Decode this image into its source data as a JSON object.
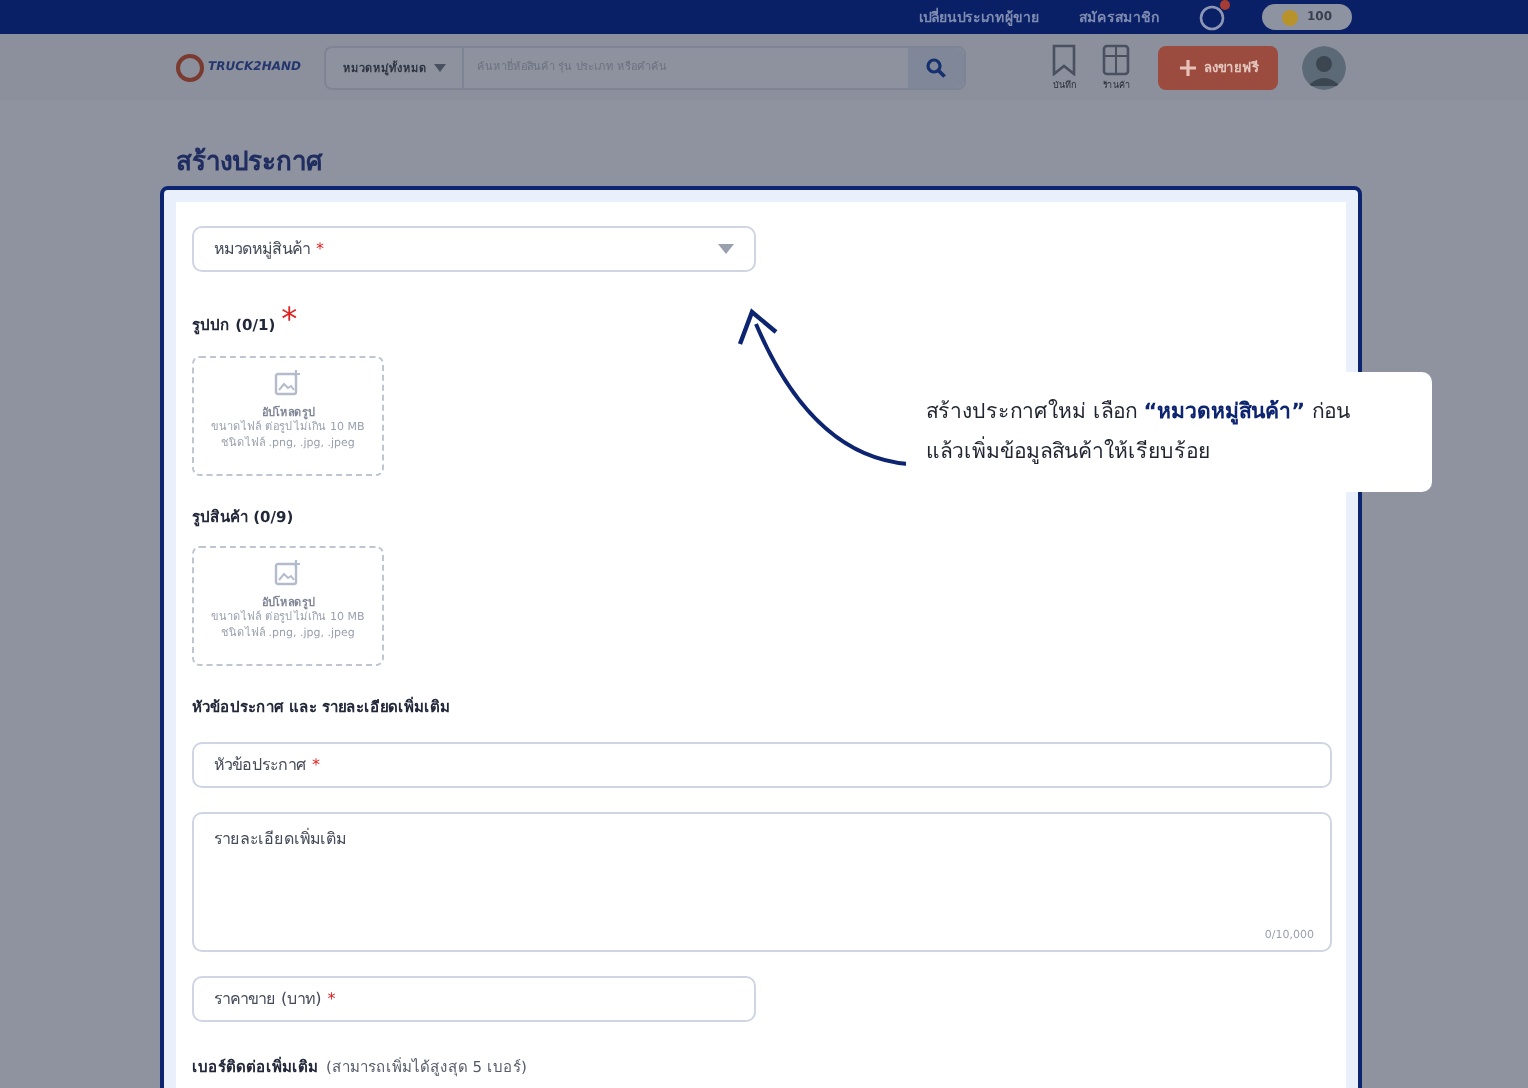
{
  "top_bar": {
    "links": [
      "เปลี่ยนประเภทผู้ขาย",
      "สมัครสมาชิก"
    ],
    "notification_badge": true,
    "coins": "100"
  },
  "header": {
    "logo": "TRUCK2HAND",
    "category_select": "หมวดหมู่ทั้งหมด",
    "search": {
      "placeholder": "ค้นหายี่ห้อสินค้า รุ่น ประเภท หรือคำค้น"
    },
    "icons": [
      {
        "label": "บันทึก"
      },
      {
        "label": "ร้านค้า"
      }
    ],
    "post_button": "ลงขายฟรี"
  },
  "page_title": "สร้างประกาศ",
  "form": [
    {
      "kind": "select",
      "label": "หมวดหมู่สินค้า",
      "required_mark": "*"
    },
    {
      "kind": "upload",
      "label": "รูปปก (0/1)",
      "required_mark": "*",
      "title": "อัปโหลดรูป",
      "lines": [
        "ขนาดไฟล์ ต่อรูป ไม่เกิน 10 MB",
        "ชนิดไฟล์ .png, .jpg, .jpeg"
      ]
    },
    {
      "kind": "upload",
      "label": "รูปสินค้า (0/9)",
      "title": "อัปโหลดรูป",
      "lines": [
        "ขนาดไฟล์ ต่อรูป ไม่เกิน 10 MB",
        "ชนิดไฟล์ .png, .jpg, .jpeg"
      ]
    },
    {
      "kind": "heading",
      "label": "หัวข้อประกาศ และ รายละเอียดเพิ่มเติม"
    },
    {
      "kind": "input",
      "label": "หัวข้อประกาศ",
      "required_mark": "*",
      "wide": true
    },
    {
      "kind": "textarea",
      "label": "รายละเอียดเพิ่มเติม",
      "counter": "0/10,000"
    },
    {
      "kind": "input",
      "label": "ราคาขาย (บาท)",
      "required_mark": "*",
      "wide": false
    },
    {
      "kind": "heading",
      "label": "เบอร์ติดต่อเพิ่มเติม",
      "note": "(สามารถเพิ่มได้สูงสุด 5 เบอร์)"
    }
  ],
  "tooltip": "สร้างประกาศใหม่ เลือก **“หมวดหมู่สินค้า”** ก่อน\nแล้วเพิ่มข้อมูลสินค้าให้เรียบร้อย"
}
